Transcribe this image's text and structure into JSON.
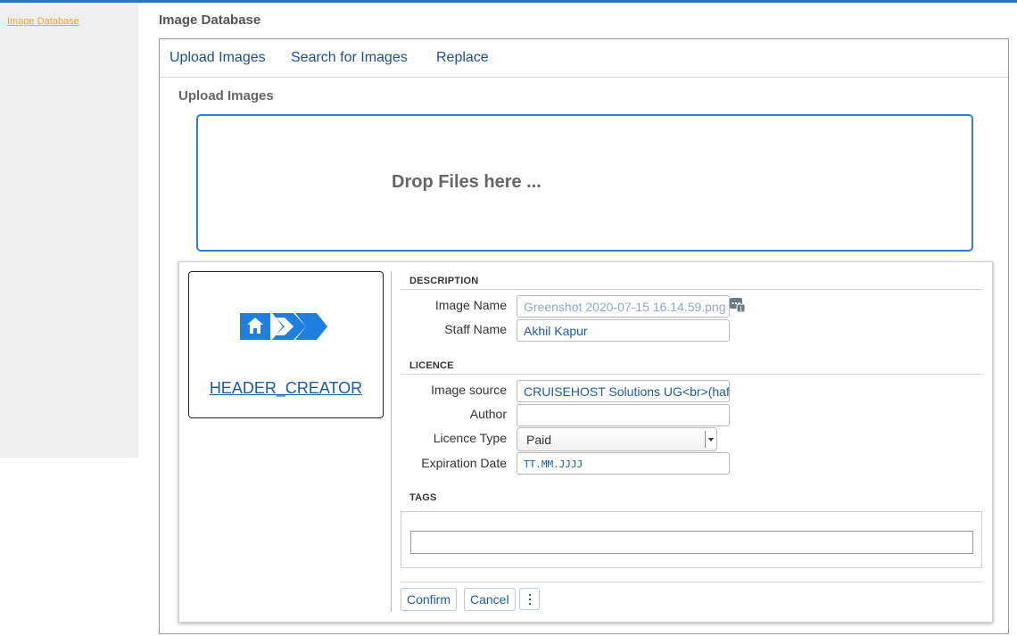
{
  "sidebar": {
    "link": "Image Database"
  },
  "page": {
    "title": "Image Database"
  },
  "tabs": [
    {
      "label": "Upload Images"
    },
    {
      "label": "Search for Images"
    },
    {
      "label": "Replace"
    }
  ],
  "upload": {
    "section_title": "Upload Images",
    "dropzone_text": "Drop Files here ..."
  },
  "item": {
    "thumbnail_caption": "HEADER_CREATOR",
    "groups": {
      "description": "DESCRIPTION",
      "licence": "LICENCE",
      "tags": "TAGS"
    },
    "fields": {
      "image_name": {
        "label": "Image Name",
        "value": "Greenshot 2020-07-15 16.14.59.png"
      },
      "staff_name": {
        "label": "Staff Name",
        "value": "Akhil Kapur"
      },
      "image_source": {
        "label": "Image source",
        "value": "CRUISEHOST Solutions UG<br>(haftungsbeschränkt)"
      },
      "author": {
        "label": "Author",
        "value": ""
      },
      "licence_type": {
        "label": "Licence Type",
        "selected": "Paid"
      },
      "expiration_date": {
        "label": "Expiration Date",
        "placeholder": "TT.MM.JJJJ"
      }
    },
    "buttons": {
      "confirm": "Confirm",
      "cancel": "Cancel"
    }
  },
  "colors": {
    "accent": "#1e78c8",
    "link_orange": "#f5a623",
    "link_blue": "#1c5aa6",
    "logo_blue": "#1f7ee0"
  }
}
